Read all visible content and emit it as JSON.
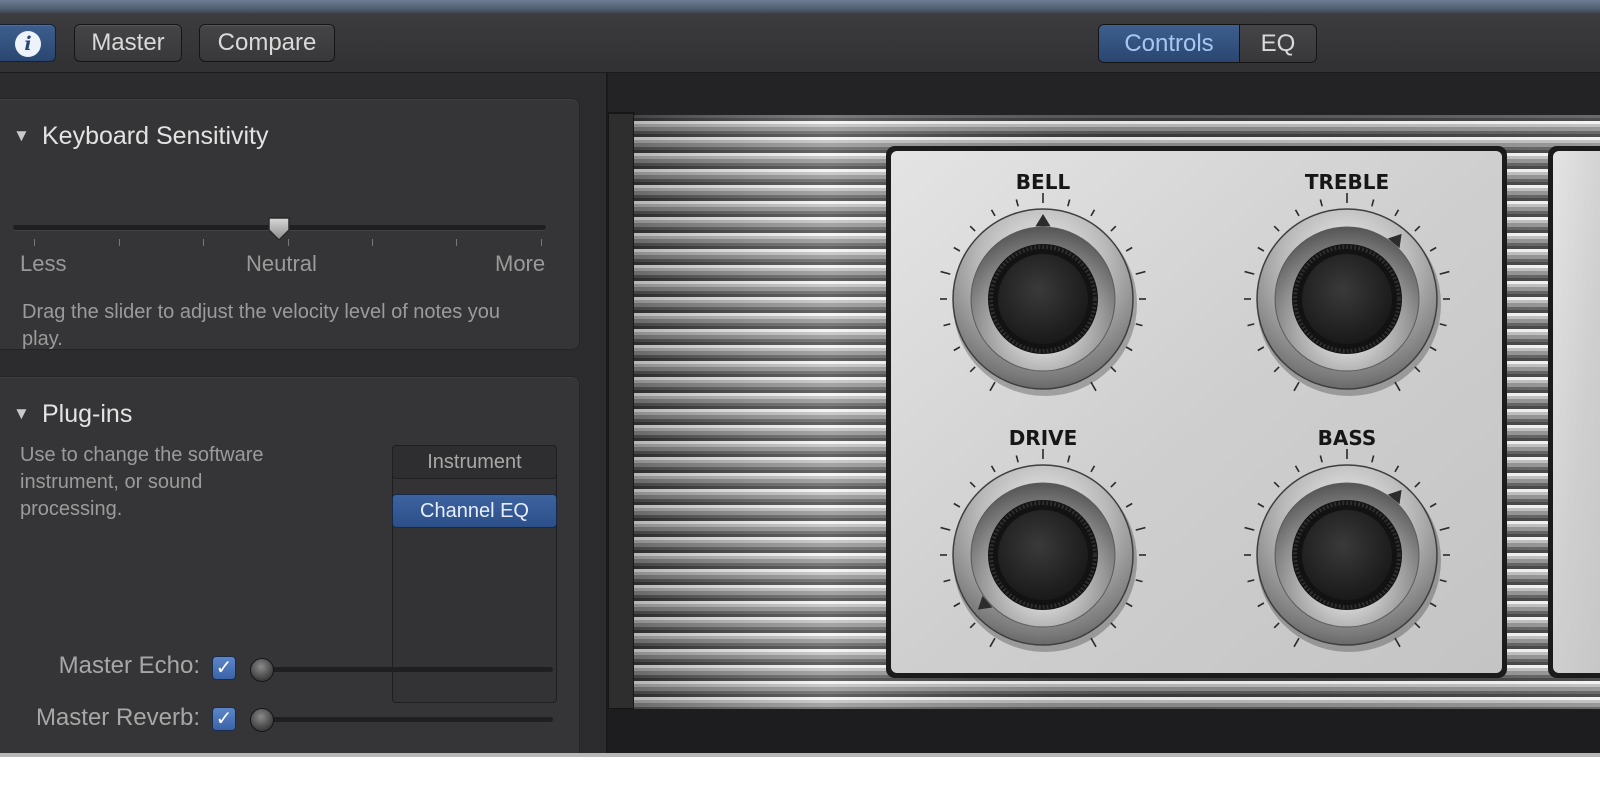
{
  "toolbar": {
    "info_icon": "i",
    "master_label": "Master",
    "compare_label": "Compare",
    "tabs": [
      {
        "label": "Controls",
        "selected": true
      },
      {
        "label": "EQ",
        "selected": false
      }
    ]
  },
  "keyboard_sensitivity": {
    "title": "Keyboard Sensitivity",
    "left_label": "Less",
    "center_label": "Neutral",
    "right_label": "More",
    "value": 0.5,
    "help": "Drag the slider to adjust the velocity level of notes you play."
  },
  "plugins": {
    "title": "Plug-ins",
    "help": "Use to change the software instrument, or sound processing.",
    "slots": [
      "Instrument",
      "Channel EQ"
    ],
    "selected_slot": "Channel EQ"
  },
  "effects": [
    {
      "label": "Master Echo:",
      "checked": true,
      "value": 0
    },
    {
      "label": "Master Reverb:",
      "checked": true,
      "value": 0
    }
  ],
  "knobs": {
    "bell": "BELL",
    "treble": "TREBLE",
    "drive": "DRIVE",
    "bass": "BASS"
  },
  "colors": {
    "accent": "#2f5190",
    "segment_text_selected": "#a8c6f2",
    "checkbox": "#4a74b8"
  }
}
